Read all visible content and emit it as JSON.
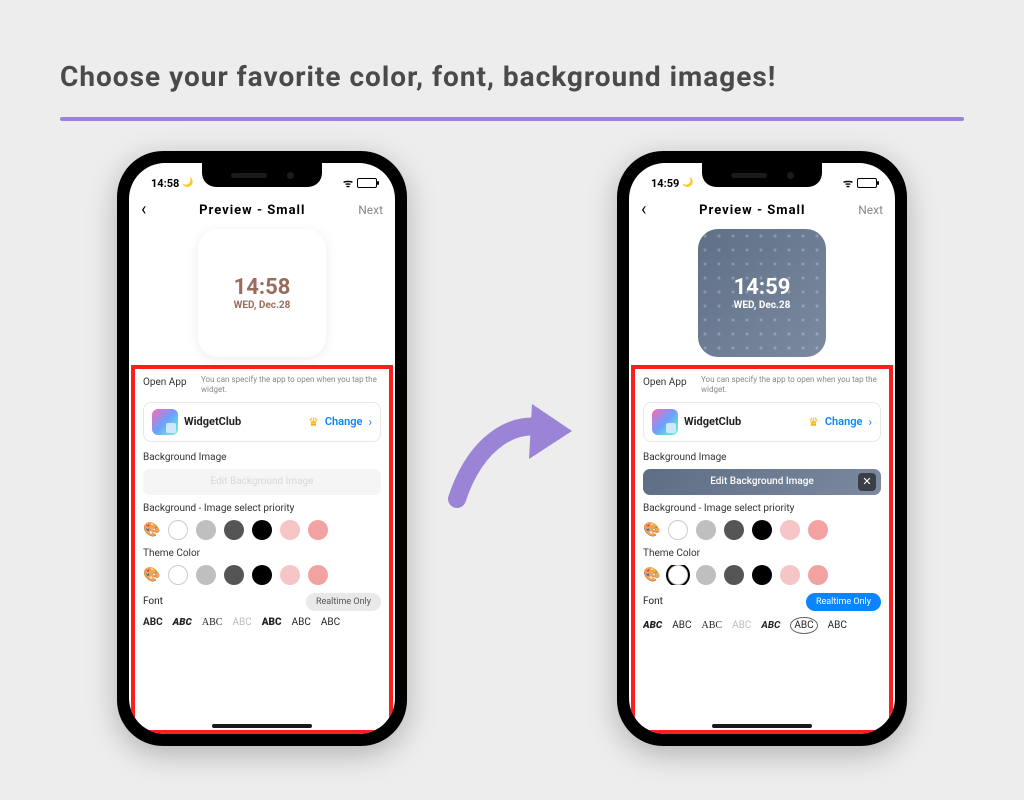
{
  "heading": "Choose your favorite color, font, background images!",
  "status": {
    "time_left": "14:58",
    "time_right": "14:59"
  },
  "nav": {
    "title": "Preview - Small",
    "next": "Next"
  },
  "widget": {
    "left": {
      "time": "14:58",
      "date": "WED, Dec.28"
    },
    "right": {
      "time": "14:59",
      "date": "WED, Dec.28"
    }
  },
  "settings": {
    "open_app_label": "Open App",
    "open_app_hint": "You can specify the app to open when you tap the widget.",
    "app_name": "WidgetClub",
    "change": "Change",
    "bg_image_label": "Background Image",
    "edit_bg": "Edit Background Image",
    "bg_priority_label": "Background - Image select priority",
    "theme_color_label": "Theme Color",
    "font_label": "Font",
    "realtime": "Realtime Only",
    "swatches": [
      {
        "c": "#ffffff",
        "outline": true
      },
      {
        "c": "#bfbfbf"
      },
      {
        "c": "#555555"
      },
      {
        "c": "#000000"
      },
      {
        "c": "#f6c6c6"
      },
      {
        "c": "#f3a2a2"
      }
    ],
    "abc": [
      "ABC",
      "ABC",
      "ABC",
      "ABC",
      "ABC",
      "ABC",
      "ABC"
    ]
  }
}
